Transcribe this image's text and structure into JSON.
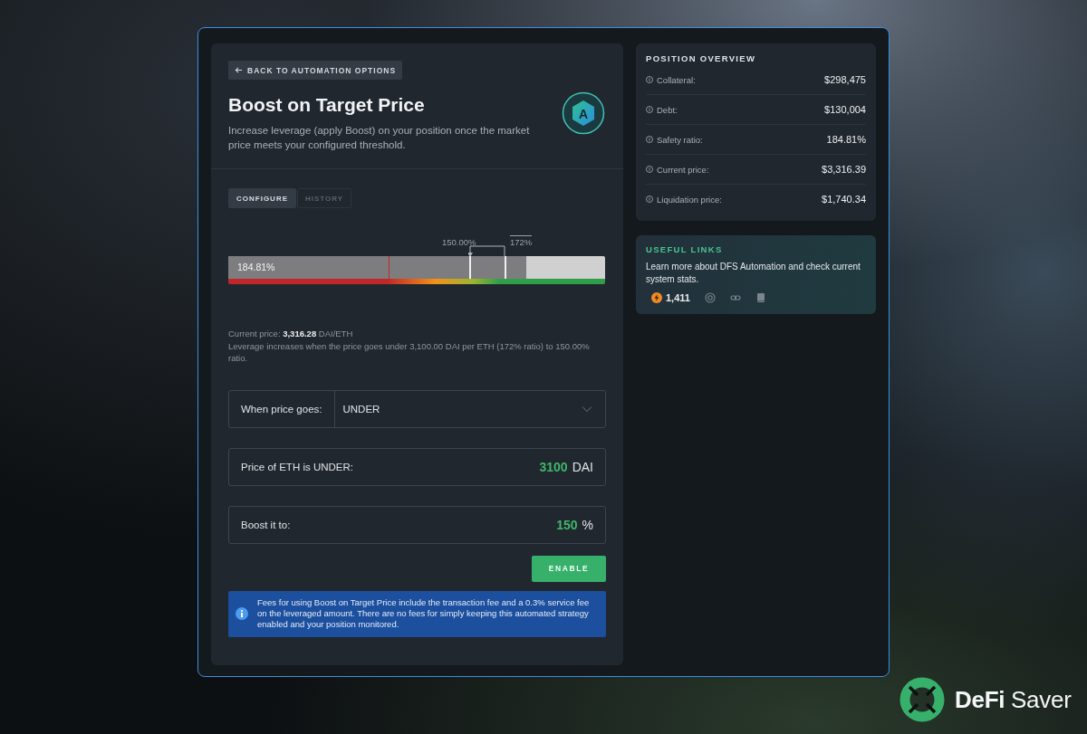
{
  "back_button": "BACK TO AUTOMATION OPTIONS",
  "title": "Boost on Target Price",
  "description": "Increase leverage (apply Boost) on your position once the market price meets your configured threshold.",
  "badge": "A",
  "tabs": [
    {
      "label": "CONFIGURE",
      "selected": true
    },
    {
      "label": "HISTORY",
      "selected": false
    }
  ],
  "gauge": {
    "reading": "184.81%",
    "level": 0.79,
    "target_label": "150.00%",
    "trigger_label": "172%"
  },
  "current_price": "Current price: **3,316.28** DAI/ETH",
  "explanation": "Leverage increases when the price goes under 3,100.00 DAI per ETH (172% ratio) to 150.00% ratio.",
  "fields": [
    {
      "kind": "select",
      "label": "When price goes:",
      "value": "UNDER"
    },
    {
      "kind": "amount",
      "label": "Price of ETH is UNDER:",
      "value": "3100",
      "unit": "DAI"
    },
    {
      "kind": "amount",
      "label": "Boost it to:",
      "value": "150",
      "unit": "%"
    }
  ],
  "enable_button": "ENABLE",
  "notice": "Fees for using Boost on Target Price include the transaction fee and a 0.3% service fee on the leveraged amount. There are no fees for simply keeping this automated strategy enabled and your position monitored.",
  "overview": {
    "title": "POSITION OVERVIEW",
    "rows": [
      {
        "label": "Collateral:",
        "value": "$298,475"
      },
      {
        "label": "Debt:",
        "value": "$130,004"
      },
      {
        "label": "Safety ratio:",
        "value": "184.81%"
      },
      {
        "label": "Current price:",
        "value": "$3,316.39"
      },
      {
        "label": "Liquidation price:",
        "value": "$1,740.34"
      }
    ]
  },
  "links": {
    "title": "USEFUL LINKS",
    "text": "Learn more about DFS Automation and check current system stats.",
    "count": "1,411"
  },
  "brand": "**DeFi** Saver"
}
